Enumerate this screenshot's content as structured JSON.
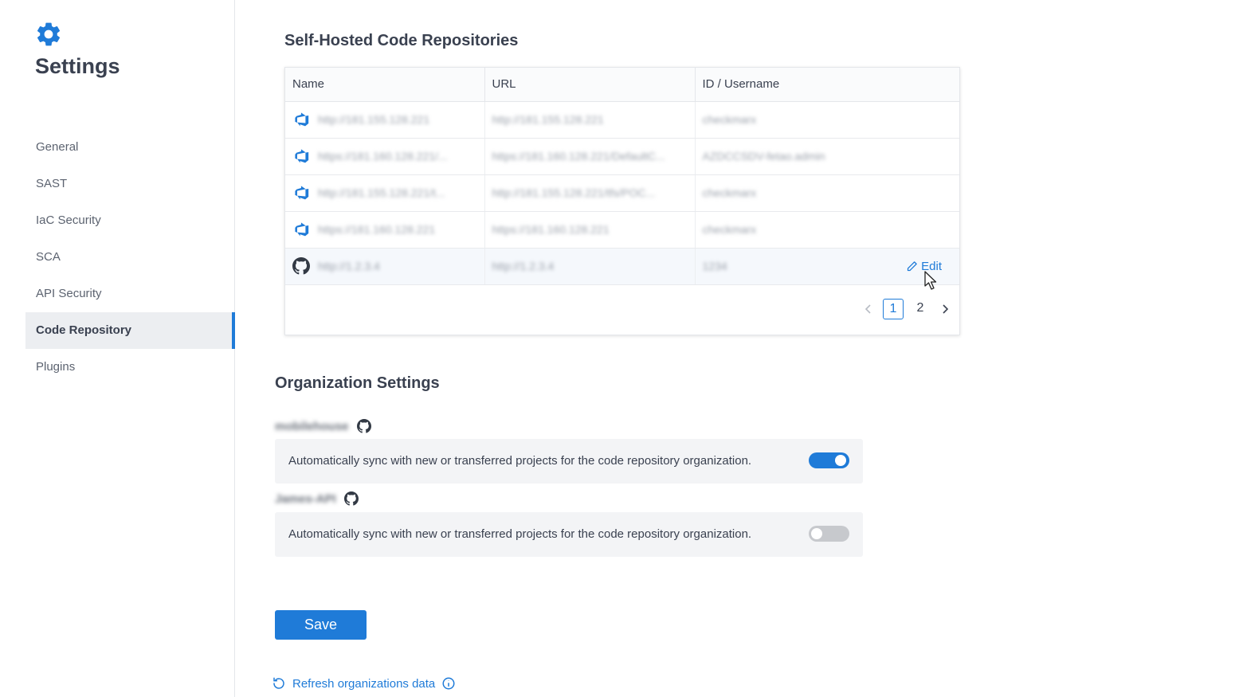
{
  "sidebar": {
    "app_icon": "gear-icon",
    "title": "Settings",
    "items": [
      {
        "label": "General",
        "active": false
      },
      {
        "label": "SAST",
        "active": false
      },
      {
        "label": "IaC Security",
        "active": false
      },
      {
        "label": "SCA",
        "active": false
      },
      {
        "label": "API Security",
        "active": false
      },
      {
        "label": "Code Repository",
        "active": true
      },
      {
        "label": "Plugins",
        "active": false
      }
    ]
  },
  "repos": {
    "title": "Self-Hosted Code Repositories",
    "columns": [
      "Name",
      "URL",
      "ID / Username"
    ],
    "rows": [
      {
        "provider_icon": "azure-devops-icon",
        "name": "http://181.155.128.221",
        "url": "http://181.155.128.221",
        "id": "checkmarx"
      },
      {
        "provider_icon": "azure-devops-icon",
        "name": "https://181.160.128.221/...",
        "url": "https://181.160.128.221/DefaultC...",
        "id": "AZDCCSDV-fetao.admin"
      },
      {
        "provider_icon": "azure-devops-icon",
        "name": "http://181.155.128.221/t...",
        "url": "http://181.155.128.221/tfs/POC...",
        "id": "checkmarx"
      },
      {
        "provider_icon": "azure-devops-icon",
        "name": "https://181.160.128.221",
        "url": "https://181.160.128.221",
        "id": "checkmarx"
      },
      {
        "provider_icon": "github-icon",
        "name": "http://1.2.3.4",
        "url": "http://1.2.3.4",
        "id": "1234"
      }
    ],
    "edit_label": "Edit",
    "pagination": {
      "pages": [
        "1",
        "2"
      ],
      "current": "1"
    }
  },
  "org_settings": {
    "title": "Organization Settings",
    "orgs": [
      {
        "name": "mobilehouse",
        "icon": "github-icon",
        "sync_text": "Automatically sync with new or transferred projects for the code repository organization.",
        "enabled": true
      },
      {
        "name": "James-API",
        "icon": "github-icon",
        "sync_text": "Automatically sync with new or transferred projects for the code repository organization.",
        "enabled": false
      }
    ]
  },
  "actions": {
    "save_label": "Save",
    "refresh_label": "Refresh organizations data"
  },
  "colors": {
    "accent": "#1f7bd8",
    "active_nav_bg": "#eceef1",
    "toggle_off": "#c7c9cd"
  }
}
